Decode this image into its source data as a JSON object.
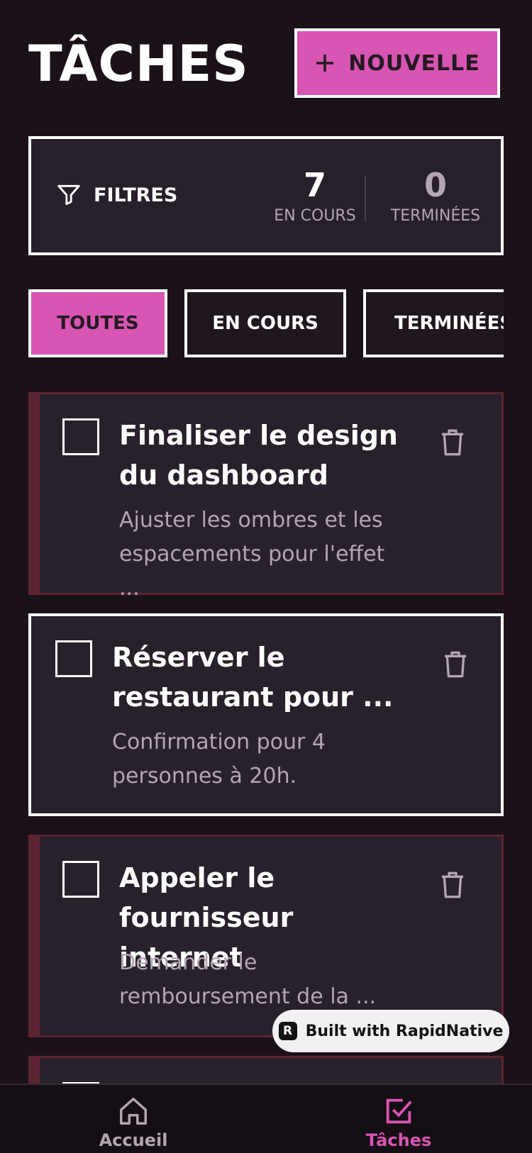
{
  "header": {
    "title": "TÂCHES",
    "new_button": {
      "icon": "plus-icon",
      "label": "NOUVELLE"
    }
  },
  "stats": {
    "filters_icon": "filter-icon",
    "filters_label": "FILTRES",
    "in_progress": {
      "value": "7",
      "label": "EN COURS"
    },
    "done": {
      "value": "0",
      "label": "TERMINÉES"
    }
  },
  "tabs": [
    {
      "label": "TOUTES",
      "active": true
    },
    {
      "label": "EN COURS",
      "active": false
    },
    {
      "label": "TERMINÉES",
      "active": false
    }
  ],
  "tasks": [
    {
      "title": "Finaliser le design du dashboard",
      "description": "Ajuster les ombres et les espacements pour l'effet ...",
      "checked": false
    },
    {
      "title": "Réserver le restaurant pour ...",
      "description": "Confirmation pour 4 personnes à 20h.",
      "checked": false
    },
    {
      "title": "Appeler le fournisseur internet",
      "description": "Demander le remboursement de la ...",
      "checked": false
    }
  ],
  "badge": {
    "logo": "R",
    "label": "Built with RapidNative"
  },
  "bottom_nav": [
    {
      "icon": "home-icon",
      "label": "Accueil",
      "active": false
    },
    {
      "icon": "checkbox-icon",
      "label": "Tâches",
      "active": true
    }
  ],
  "colors": {
    "background": "#1b1219",
    "card": "#28202a",
    "accent": "#d855b3",
    "card_border": "#5e2332",
    "muted_text": "#b4a5b3"
  }
}
